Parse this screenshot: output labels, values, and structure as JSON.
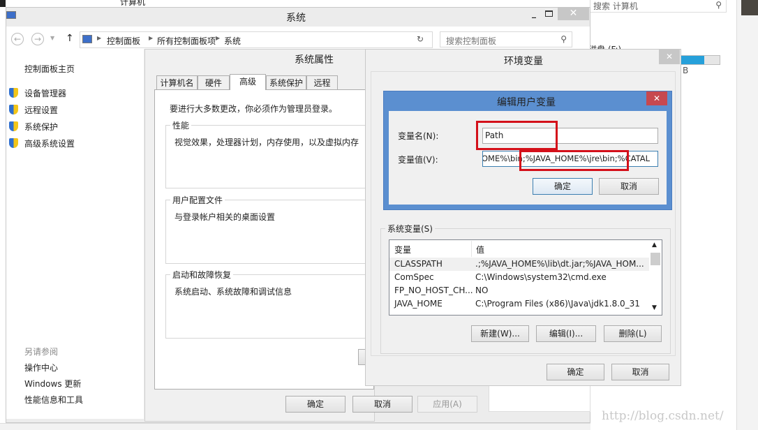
{
  "background_window": {
    "breadcrumb": "计算机",
    "search_placeholder": "搜索 计算机",
    "drive_label": "磁盘 (F:)",
    "drive_size_fragment": "B",
    "drive_usage_percent": 60
  },
  "system_window": {
    "title": "系统",
    "address": [
      "控制面板",
      "所有控制面板项",
      "系统"
    ],
    "search_placeholder": "搜索控制面板",
    "sidebar": {
      "home": "控制面板主页",
      "items": [
        {
          "label": "设备管理器",
          "icon": "shield-icon"
        },
        {
          "label": "远程设置",
          "icon": "shield-icon"
        },
        {
          "label": "系统保护",
          "icon": "shield-icon"
        },
        {
          "label": "高级系统设置",
          "icon": "shield-icon"
        }
      ],
      "see_also": "另请参阅",
      "links": [
        "操作中心",
        "Windows 更新",
        "性能信息和工具"
      ]
    }
  },
  "sys_props": {
    "title": "系统属性",
    "tabs": [
      "计算机名",
      "硬件",
      "高级",
      "系统保护",
      "远程"
    ],
    "active_tab": "高级",
    "admin_note": "要进行大多数更改，你必须作为管理员登录。",
    "groups": [
      {
        "label": "性能",
        "text": "视觉效果，处理器计划，内存使用，以及虚拟内存"
      },
      {
        "label": "用户配置文件",
        "text": "与登录帐户相关的桌面设置"
      },
      {
        "label": "启动和故障恢复",
        "text": "系统启动、系统故障和调试信息"
      }
    ],
    "ok": "确定",
    "cancel": "取消",
    "apply": "应用(A)"
  },
  "env_vars": {
    "title": "环境变量",
    "system_group": "系统变量(S)",
    "columns": [
      "变量",
      "值"
    ],
    "rows": [
      {
        "name": "CLASSPATH",
        "value": ".;%JAVA_HOME%\\lib\\dt.jar;%JAVA_HOM..."
      },
      {
        "name": "ComSpec",
        "value": "C:\\Windows\\system32\\cmd.exe"
      },
      {
        "name": "FP_NO_HOST_CH...",
        "value": "NO"
      },
      {
        "name": "JAVA_HOME",
        "value": "C:\\Program Files (x86)\\Java\\jdk1.8.0_31"
      }
    ],
    "new": "新建(W)...",
    "edit": "编辑(I)...",
    "delete": "删除(L)",
    "ok": "确定",
    "cancel": "取消"
  },
  "edit_var": {
    "title": "编辑用户变量",
    "name_label": "变量名(N):",
    "name_value": "Path",
    "value_label": "变量值(V):",
    "value_value": "OME%\\bin;%JAVA_HOME%\\jre\\bin;%CATAL",
    "ok": "确定",
    "cancel": "取消",
    "accent": "#5b8fd0",
    "highlight": "#d4101a"
  },
  "watermark": "http://blog.csdn.net/"
}
